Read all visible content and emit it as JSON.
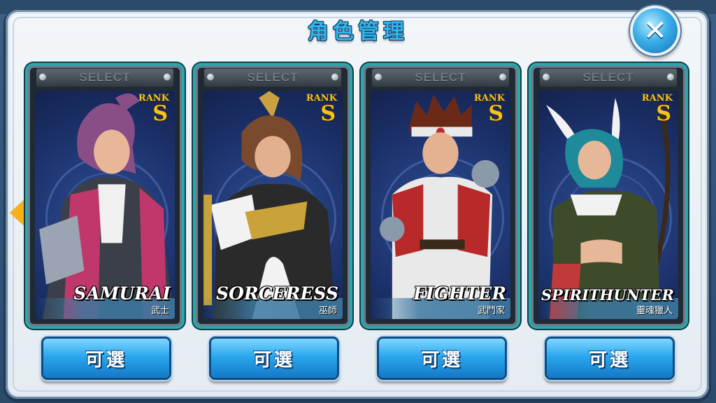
{
  "window": {
    "title": "角色管理"
  },
  "close_button": {
    "icon": "close-icon",
    "glyph": "✕"
  },
  "colors": {
    "accent": "#33b4ea",
    "rank": "#f4c31e",
    "card_border": "#2da6b0",
    "button": "#2ba7ee"
  },
  "characters": [
    {
      "select_label": "SELECT",
      "rank_label": "RANK",
      "rank": "S",
      "name": "SAMURAI",
      "name_cn": "武士",
      "button_label": "可選",
      "palette": {
        "hair": "#8a4e86",
        "outfit": "#c0386b",
        "skin": "#e7b798"
      }
    },
    {
      "select_label": "SELECT",
      "rank_label": "RANK",
      "rank": "S",
      "name": "SORCERESS",
      "name_cn": "巫師",
      "button_label": "可選",
      "palette": {
        "hair": "#7a4a2e",
        "outfit": "#2a2a2a",
        "skin": "#e3b08f"
      }
    },
    {
      "select_label": "SELECT",
      "rank_label": "RANK",
      "rank": "S",
      "name": "FIGHTER",
      "name_cn": "武鬥家",
      "button_label": "可選",
      "palette": {
        "hair": "#6b2a18",
        "outfit": "#b82a2a",
        "skin": "#e2b291"
      }
    },
    {
      "select_label": "SELECT",
      "rank_label": "RANK",
      "rank": "S",
      "name": "SPIRITHUNTER",
      "name_cn": "靈魂獵人",
      "button_label": "可選",
      "palette": {
        "hair": "#1f8a9a",
        "outfit": "#3e4b2a",
        "skin": "#e7b898"
      }
    }
  ]
}
